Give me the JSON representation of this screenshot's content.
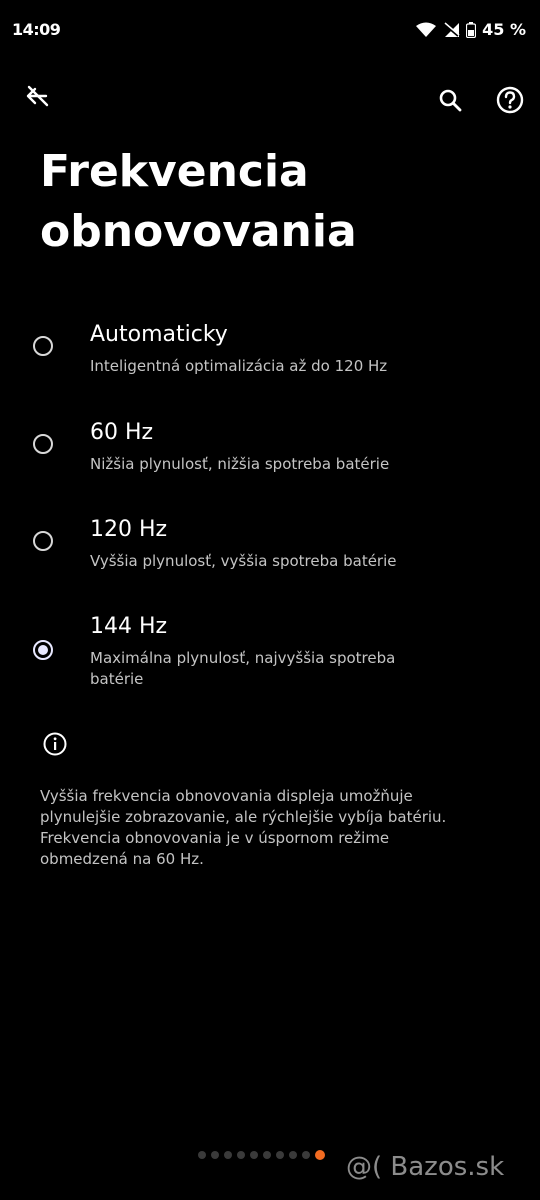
{
  "status_bar": {
    "time": "14:09",
    "battery": "45 %"
  },
  "toolbar": {
    "back_icon": "back-strikethrough-icon",
    "search_icon": "search-icon",
    "help_icon": "help-circle-icon"
  },
  "page": {
    "title": "Frekvencia\nobnovovania"
  },
  "options": [
    {
      "title": "Automaticky",
      "subtitle": "Inteligentná optimalizácia až do 120 Hz",
      "selected": false
    },
    {
      "title": "60 Hz",
      "subtitle": "Nižšia plynulosť, nižšia spotreba batérie",
      "selected": false
    },
    {
      "title": "120 Hz",
      "subtitle": "Vyššia plynulosť, vyššia spotreba batérie",
      "selected": false
    },
    {
      "title": "144 Hz",
      "subtitle": "Maximálna plynulosť, najvyššia spotreba batérie",
      "selected": true
    }
  ],
  "info": {
    "icon": "info-icon",
    "text": "Vyššia frekvencia obnovovania displeja umožňuje plynulejšie zobrazovanie, ale rýchlejšie vybíja batériu. Frekvencia obnovovania je v úspornom režime obmedzená na 60 Hz."
  },
  "pager": {
    "count": 10,
    "active_index": 9,
    "active_color": "#f26b21"
  },
  "watermark": {
    "text": "@( Bazos.sk"
  }
}
